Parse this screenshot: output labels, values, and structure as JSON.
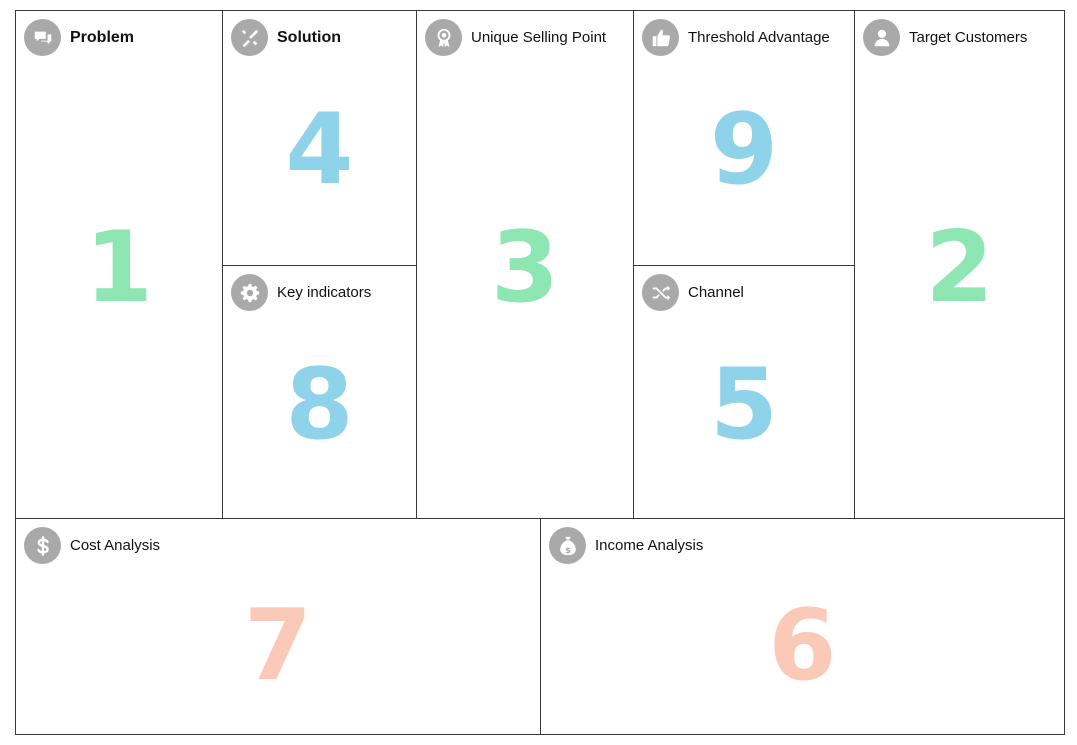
{
  "colors": {
    "green": "#8ee6b3",
    "blue": "#8fd3ea",
    "peach": "#fbc9b8",
    "icon_bg": "#a9a9a9",
    "border": "#3a3a3a"
  },
  "blocks": {
    "problem": {
      "title": "Problem",
      "number": "1",
      "icon": "speech-bubbles-icon"
    },
    "solution": {
      "title": "Solution",
      "number": "4",
      "icon": "tools-icon"
    },
    "key_indicators": {
      "title": "Key indicators",
      "number": "8",
      "icon": "gear-icon"
    },
    "usp": {
      "title": "Unique Selling Point",
      "number": "3",
      "icon": "award-ribbon-icon"
    },
    "threshold": {
      "title": "Threshold Advantage",
      "number": "9",
      "icon": "thumbs-up-icon"
    },
    "channel": {
      "title": "Channel",
      "number": "5",
      "icon": "shuffle-icon"
    },
    "target": {
      "title": "Target Customers",
      "number": "2",
      "icon": "user-icon"
    },
    "cost": {
      "title": "Cost Analysis",
      "number": "7",
      "icon": "dollar-icon"
    },
    "income": {
      "title": "Income Analysis",
      "number": "6",
      "icon": "money-bag-icon"
    }
  }
}
